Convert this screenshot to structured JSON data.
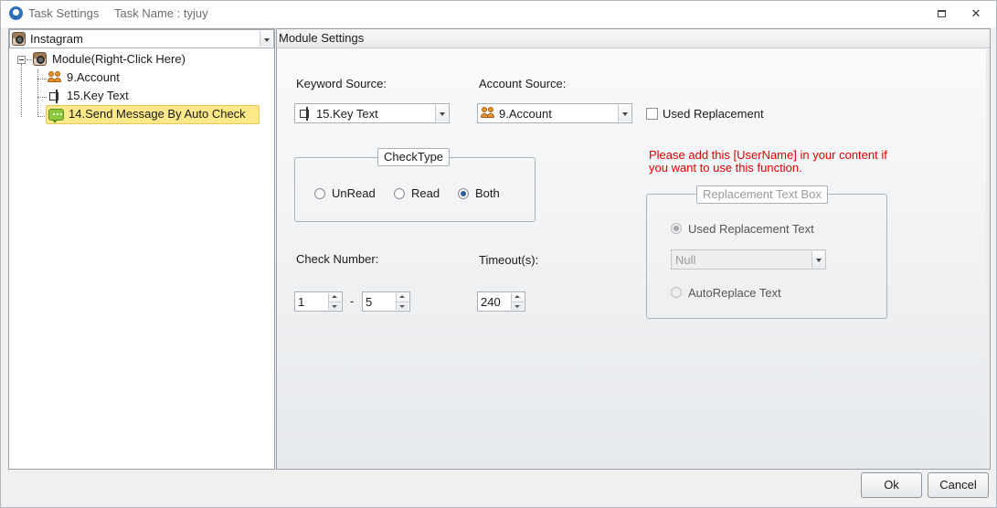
{
  "window": {
    "title": "Task Settings",
    "task_name": "Task Name : tyjuy",
    "restore_icon": "restore-icon",
    "close_glyph": "✕"
  },
  "left": {
    "platform_selected": "Instagram",
    "tree": {
      "root": "Module(Right-Click Here)",
      "items": [
        {
          "label": "9.Account",
          "icon": "people-icon"
        },
        {
          "label": "15.Key Text",
          "icon": "key-text-icon"
        },
        {
          "label": "14.Send Message By Auto Check",
          "icon": "message-icon",
          "selected": true
        }
      ]
    }
  },
  "module": {
    "header": "Module Settings",
    "keyword_source_label": "Keyword Source:",
    "keyword_source_value": "15.Key Text",
    "account_source_label": "Account Source:",
    "account_source_value": "9.Account",
    "used_replacement_label": "Used  Replacement",
    "used_replacement_checked": false,
    "checktype": {
      "title": "CheckType",
      "options": [
        "UnRead",
        "Read",
        "Both"
      ],
      "selected": "Both"
    },
    "note": "Please add this [UserName] in your content if you want to use this function.",
    "replacement_box": {
      "title": "Replacement Text Box",
      "used_text_label": "Used Replacement Text",
      "select_value": "Null",
      "auto_label": "AutoReplace Text",
      "enabled": false
    },
    "check_number_label": "Check Number:",
    "check_min": "1",
    "check_sep": "-",
    "check_max": "5",
    "timeout_label": "Timeout(s):",
    "timeout_value": "240"
  },
  "footer": {
    "ok": "Ok",
    "cancel": "Cancel"
  },
  "colors": {
    "selection": "#fde98a",
    "note_red": "#e00000",
    "radio_checked": "#2f5f94"
  }
}
